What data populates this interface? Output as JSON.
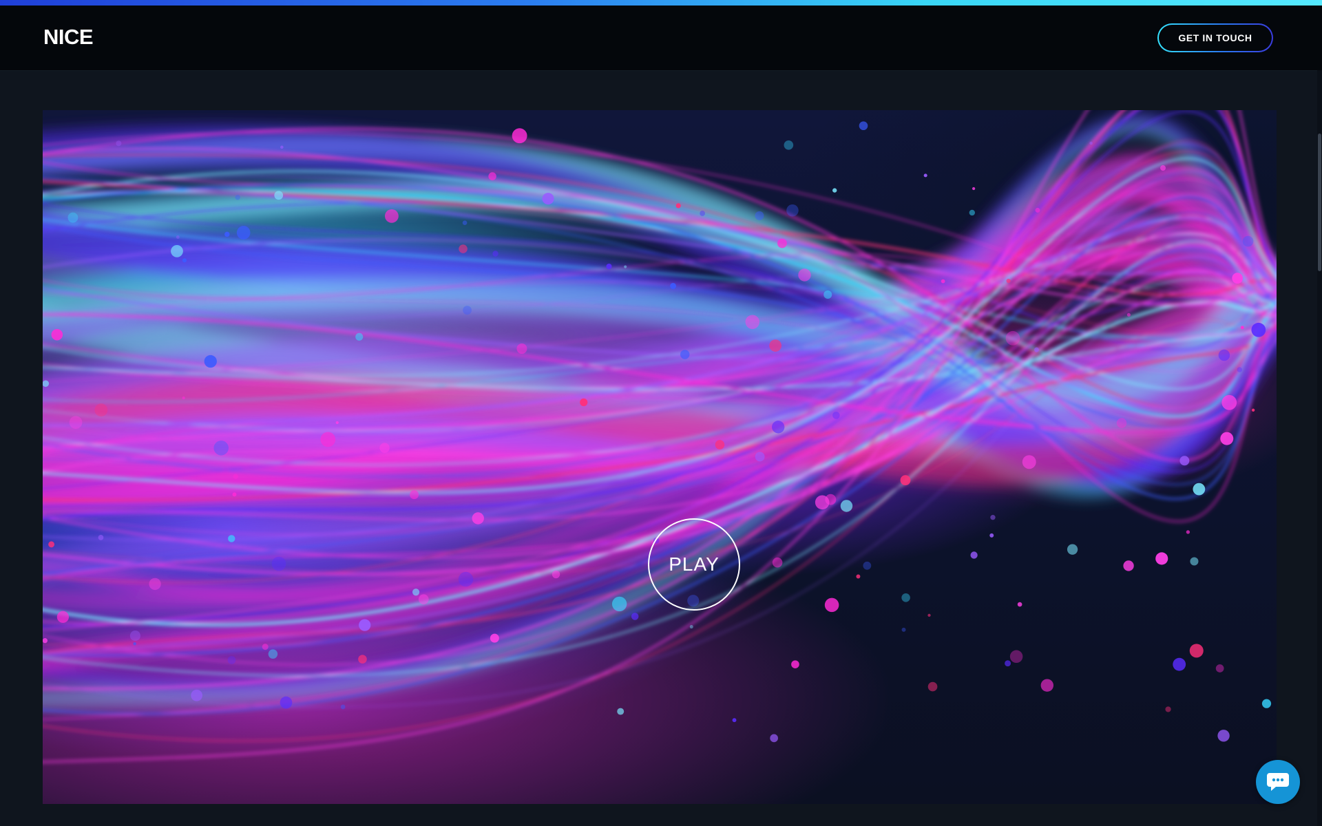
{
  "header": {
    "logo_text": "NICE",
    "cta_label": "GET IN TOUCH"
  },
  "video": {
    "play_label": "PLAY"
  },
  "chat": {
    "icon": "chat-bubble-icon"
  },
  "colors": {
    "accent_cyan": "#35e3ff",
    "accent_blue": "#2a7bf2",
    "chat_button": "#1594d6",
    "header_bg": "#04070b",
    "page_bg": "#0f151e"
  }
}
